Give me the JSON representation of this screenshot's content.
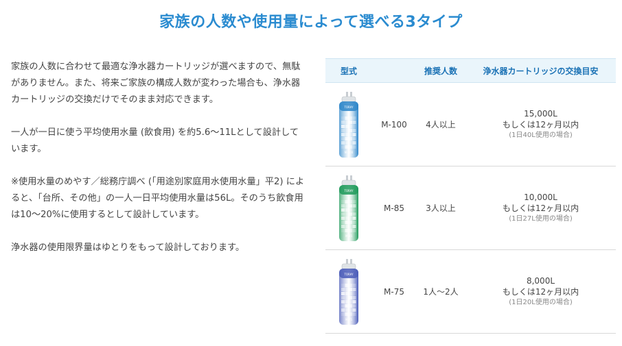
{
  "title": "家族の人数や使用量によって選べる3タイプ",
  "paragraphs": [
    "家族の人数に合わせて最適な浄水器カートリッジが選べますので、無駄がありません。また、将来ご家族の構成人数が変わった場合も、浄水器カートリッジの交換だけでそのまま対応できます。",
    "一人が一日に使う平均使用水量 (飲食用) を約5.6～11Lとして設計しています。",
    "※使用水量のめやす／総務庁調べ (「用途別家庭用水使用水量」平2) によると、「台所、その他」の一人一日平均使用水量は56L。そのうち飲食用は10～20%に使用するとして設計しています。",
    "浄水器の使用限界量はゆとりをもって設計しております。"
  ],
  "table": {
    "headers": [
      "型式",
      "推奨人数",
      "浄水器カートリッジの交換目安"
    ],
    "rows": [
      {
        "model": "M-100",
        "people": "4人以上",
        "volume": "15,000L",
        "period": "もしくは12ヶ月以内",
        "note": "(1日40L使用の場合)",
        "color": "#2e86c9",
        "label": "TORAY",
        "model_mark": "M-100"
      },
      {
        "model": "M-85",
        "people": "3人以上",
        "volume": "10,000L",
        "period": "もしくは12ヶ月以内",
        "note": "(1日27L使用の場合)",
        "color": "#1f9a5a",
        "label": "TORAY",
        "model_mark": "M-85"
      },
      {
        "model": "M-75",
        "people": "1人～2人",
        "volume": "8,000L",
        "period": "もしくは12ヶ月以内",
        "note": "(1日20L使用の場合)",
        "color": "#4a5cb8",
        "label": "TORAY",
        "model_mark": "M-75"
      }
    ]
  }
}
